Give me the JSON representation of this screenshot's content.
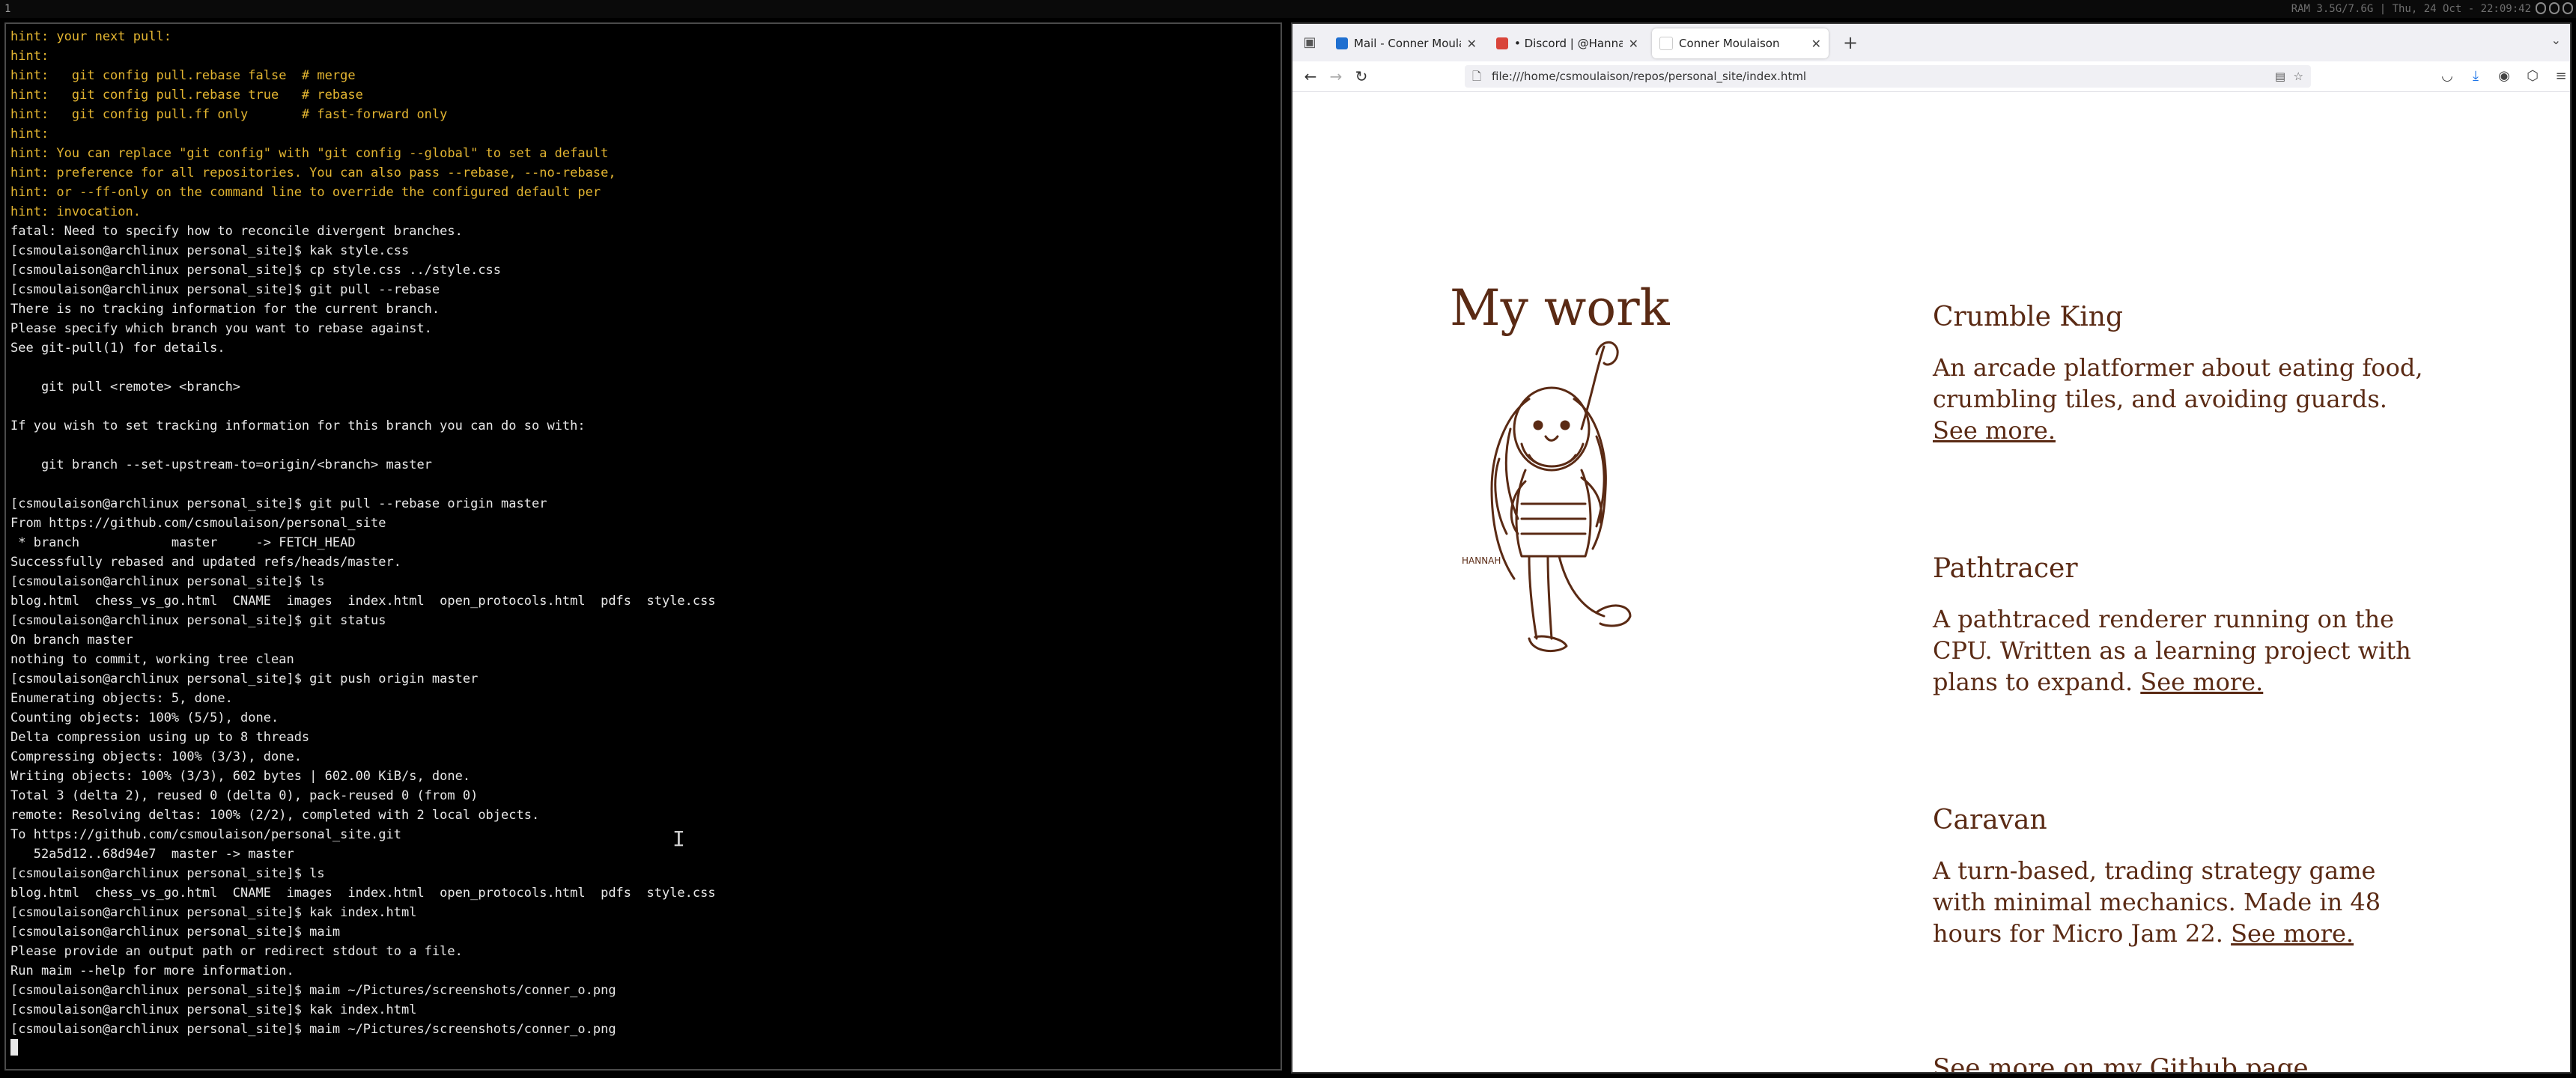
{
  "statusbar": {
    "workspace": "1",
    "text": "RAM 3.5G/7.6G | Thu, 24 Oct - 22:09:42"
  },
  "terminal": {
    "lines": [
      {
        "t": "hint: your next pull:",
        "c": "hint"
      },
      {
        "t": "hint:",
        "c": "hint"
      },
      {
        "t": "hint:   git config pull.rebase false  # merge",
        "c": "hint"
      },
      {
        "t": "hint:   git config pull.rebase true   # rebase",
        "c": "hint"
      },
      {
        "t": "hint:   git config pull.ff only       # fast-forward only",
        "c": "hint"
      },
      {
        "t": "hint:",
        "c": "hint"
      },
      {
        "t": "hint: You can replace \"git config\" with \"git config --global\" to set a default",
        "c": "hint"
      },
      {
        "t": "hint: preference for all repositories. You can also pass --rebase, --no-rebase,",
        "c": "hint"
      },
      {
        "t": "hint: or --ff-only on the command line to override the configured default per",
        "c": "hint"
      },
      {
        "t": "hint: invocation.",
        "c": "hint"
      },
      {
        "t": "fatal: Need to specify how to reconcile divergent branches.",
        "c": ""
      },
      {
        "t": "[csmoulaison@archlinux personal_site]$ kak style.css",
        "c": ""
      },
      {
        "t": "[csmoulaison@archlinux personal_site]$ cp style.css ../style.css",
        "c": ""
      },
      {
        "t": "[csmoulaison@archlinux personal_site]$ git pull --rebase",
        "c": ""
      },
      {
        "t": "There is no tracking information for the current branch.",
        "c": ""
      },
      {
        "t": "Please specify which branch you want to rebase against.",
        "c": ""
      },
      {
        "t": "See git-pull(1) for details.",
        "c": ""
      },
      {
        "t": "",
        "c": ""
      },
      {
        "t": "    git pull <remote> <branch>",
        "c": ""
      },
      {
        "t": "",
        "c": ""
      },
      {
        "t": "If you wish to set tracking information for this branch you can do so with:",
        "c": ""
      },
      {
        "t": "",
        "c": ""
      },
      {
        "t": "    git branch --set-upstream-to=origin/<branch> master",
        "c": ""
      },
      {
        "t": "",
        "c": ""
      },
      {
        "t": "[csmoulaison@archlinux personal_site]$ git pull --rebase origin master",
        "c": ""
      },
      {
        "t": "From https://github.com/csmoulaison/personal_site",
        "c": ""
      },
      {
        "t": " * branch            master     -> FETCH_HEAD",
        "c": ""
      },
      {
        "t": "Successfully rebased and updated refs/heads/master.",
        "c": ""
      },
      {
        "t": "[csmoulaison@archlinux personal_site]$ ls",
        "c": ""
      },
      {
        "t": "blog.html  chess_vs_go.html  CNAME  images  index.html  open_protocols.html  pdfs  style.css",
        "c": ""
      },
      {
        "t": "[csmoulaison@archlinux personal_site]$ git status",
        "c": ""
      },
      {
        "t": "On branch master",
        "c": ""
      },
      {
        "t": "nothing to commit, working tree clean",
        "c": ""
      },
      {
        "t": "[csmoulaison@archlinux personal_site]$ git push origin master",
        "c": ""
      },
      {
        "t": "Enumerating objects: 5, done.",
        "c": ""
      },
      {
        "t": "Counting objects: 100% (5/5), done.",
        "c": ""
      },
      {
        "t": "Delta compression using up to 8 threads",
        "c": ""
      },
      {
        "t": "Compressing objects: 100% (3/3), done.",
        "c": ""
      },
      {
        "t": "Writing objects: 100% (3/3), 602 bytes | 602.00 KiB/s, done.",
        "c": ""
      },
      {
        "t": "Total 3 (delta 2), reused 0 (delta 0), pack-reused 0 (from 0)",
        "c": ""
      },
      {
        "t": "remote: Resolving deltas: 100% (2/2), completed with 2 local objects.",
        "c": ""
      },
      {
        "t": "To https://github.com/csmoulaison/personal_site.git",
        "c": ""
      },
      {
        "t": "   52a5d12..68d94e7  master -> master",
        "c": ""
      },
      {
        "t": "[csmoulaison@archlinux personal_site]$ ls",
        "c": ""
      },
      {
        "t": "blog.html  chess_vs_go.html  CNAME  images  index.html  open_protocols.html  pdfs  style.css",
        "c": ""
      },
      {
        "t": "[csmoulaison@archlinux personal_site]$ kak index.html",
        "c": ""
      },
      {
        "t": "[csmoulaison@archlinux personal_site]$ maim",
        "c": ""
      },
      {
        "t": "Please provide an output path or redirect stdout to a file.",
        "c": ""
      },
      {
        "t": "Run maim --help for more information.",
        "c": ""
      },
      {
        "t": "[csmoulaison@archlinux personal_site]$ maim ~/Pictures/screenshots/conner_o.png",
        "c": ""
      },
      {
        "t": "[csmoulaison@archlinux personal_site]$ kak index.html",
        "c": ""
      },
      {
        "t": "[csmoulaison@archlinux personal_site]$ maim ~/Pictures/screenshots/conner_o.png",
        "c": ""
      }
    ]
  },
  "browser": {
    "tabs": [
      {
        "title": "Mail - Conner Moulaison",
        "favicon_color": "#1f6fd0",
        "active": false
      },
      {
        "title": "• Discord | @HannahBee",
        "favicon_color": "#d9453a",
        "active": false
      },
      {
        "title": "Conner Moulaison",
        "favicon_color": "#ffffff",
        "active": true
      }
    ],
    "new_tab": "+",
    "url": "file:///home/csmoulaison/repos/personal_site/index.html"
  },
  "page": {
    "heading": "My work",
    "accent_color": "#5a2a14",
    "projects": [
      {
        "title": "Crumble King",
        "desc": "An arcade platformer about eating food, crumbling tiles, and avoiding guards.",
        "link": "See more."
      },
      {
        "title": "Pathtracer",
        "desc": "A pathtraced renderer running on the CPU. Written as a learning project with plans to expand.",
        "link": "See more."
      },
      {
        "title": "Caravan",
        "desc": "A turn-based, trading strategy game with minimal mechanics. Made in 48 hours for Micro Jam 22.",
        "link": "See more."
      }
    ],
    "github_link": "See more on my Github page.",
    "illustration_signature": "HANNAH"
  }
}
